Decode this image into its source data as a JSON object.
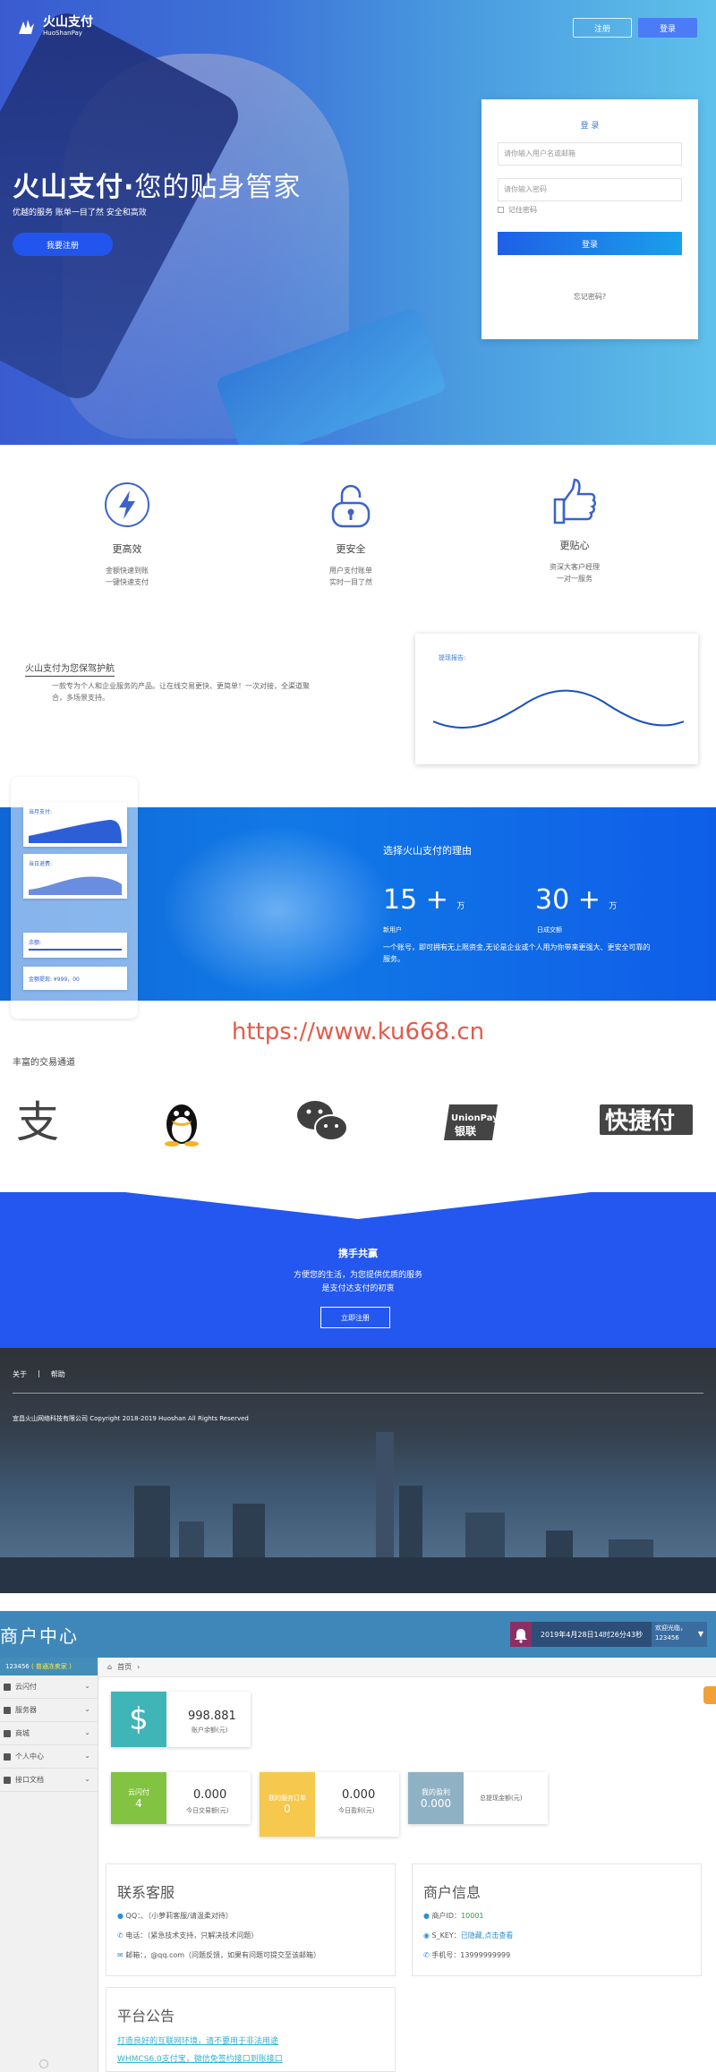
{
  "brand": {
    "name": "火山支付",
    "sub": "HuoShanPay"
  },
  "topnav": {
    "register": "注册",
    "login": "登录"
  },
  "hero": {
    "title_bold": "火山支付·",
    "title_rest": "您的贴身管家",
    "subtitle": "优越的服务  账单一目了然  安全和高效",
    "cta": "我要注册"
  },
  "login_box": {
    "title": "登 录",
    "user_placeholder": "请你输入用户名或邮箱",
    "pass_placeholder": "请你输入密码",
    "remember": "记住密码",
    "submit": "登录",
    "forgot": "忘记密码?"
  },
  "features": [
    {
      "icon": "lightning-icon",
      "name": "更高效",
      "desc1": "金额快速到账",
      "desc2": "一键快速支付"
    },
    {
      "icon": "lock-icon",
      "name": "更安全",
      "desc1": "用户支付账单",
      "desc2": "实时一目了然"
    },
    {
      "icon": "thumbs-up-icon",
      "name": "更贴心",
      "desc1": "资深大客户经理",
      "desc2": "一对一服务"
    }
  ],
  "intro": {
    "title": "火山支付为您保驾护航",
    "text": "一款专为个人和企业服务的产品。让在线交易更快、更简单！一次对接，全渠道聚合，多场景支持。"
  },
  "chart_card": {
    "label": "提现报告:"
  },
  "mockup": {
    "label1": "当月支付:",
    "label2": "当日退费:",
    "label3": "余额:",
    "label4": "金额提现: ¥999，00"
  },
  "band": {
    "reason": "选择火山支付的理由",
    "stat1_num": "15 +",
    "stat1_unit": "万",
    "stat1_label": "新用户",
    "stat2_num": "30 +",
    "stat2_unit": "万",
    "stat2_label": "日成交额",
    "note": "一个账号，即可拥有无上限资金,无论是企业或个人用为你带来更强大、更安全可靠的服务。"
  },
  "watermark": "https://www.ku668.cn",
  "channels": {
    "title": "丰富的交易通道",
    "items": [
      "支付宝",
      "QQ钱包",
      "微信支付",
      "UnionPay 银联",
      "快捷付"
    ]
  },
  "cta": {
    "title": "携手共赢",
    "line1": "方便您的生活，为您提供优质的服务",
    "line2": "是支付达支付的初衷",
    "button": "立即注册"
  },
  "footer": {
    "link1": "关于",
    "sep": "|",
    "link2": "帮助",
    "copyright": "宜昌火山网络科技有限公司 Copyright 2018-2019 Huoshan All Rights Reserved"
  },
  "merchant": {
    "brand": "商户中心",
    "datetime": "2019年4月28日14时26分43秒",
    "welcome": "欢迎光临，",
    "username": "123456",
    "uid": "123456",
    "uid_tag": "( 普通冻卖家 )",
    "sidebar": [
      "云闪付",
      "服务器",
      "商城",
      "个人中心",
      "接口文档"
    ],
    "breadcrumb": "首页",
    "balance": {
      "value": "998.881",
      "label": "账户余额(元)"
    },
    "stats": [
      {
        "tag": "云闪付",
        "count": "4",
        "value": "0.000",
        "label": "今日交易额(元)",
        "color": "#82c341"
      },
      {
        "tag": "我的服务订单",
        "count": "0",
        "value": "0.000",
        "label": "今日盈利(元)",
        "color": "#f6c94e"
      },
      {
        "tag": "我的盈利",
        "count": "0.000",
        "value": "",
        "label": "总提现金额(元)",
        "color": "#8fb1c4"
      }
    ],
    "service": {
      "title": "联系客服",
      "qq": "QQ：、（小萝莉客服/请温柔对待）",
      "phone": "电话：（紧急技术支持，只解决技术问题）",
      "email": "邮箱：，@qq.com（问题反馈，如果有问题可提交至该邮箱）"
    },
    "info": {
      "title": "商户信息",
      "pid_label": "商户ID：",
      "pid": "10001",
      "key_label": "S_KEY：",
      "key": "已隐藏,点击查看",
      "phone_label": "手机号：",
      "phone": "13999999999"
    },
    "notice": {
      "title": "平台公告",
      "items": [
        "打造良好的互联网环境，请不要用于非法用途",
        "WHMCS6.0支付宝，微信免签约接口到账接口"
      ]
    }
  },
  "colors": {
    "primary_blue": "#2357ef",
    "merchant_blue": "#438eb9",
    "watermark": "#e35b4a"
  }
}
